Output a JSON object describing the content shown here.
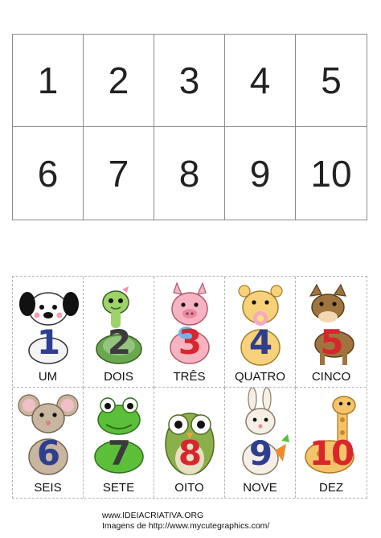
{
  "numbers_table": [
    "1",
    "2",
    "3",
    "4",
    "5",
    "6",
    "7",
    "8",
    "9",
    "10"
  ],
  "cards": [
    {
      "numeral": "1",
      "word": "UM",
      "animal": "puppy-icon",
      "color": "#2e3f8f"
    },
    {
      "numeral": "2",
      "word": "DOIS",
      "animal": "turtle-icon",
      "color": "#3b3b3b"
    },
    {
      "numeral": "3",
      "word": "TRÊS",
      "animal": "pig-icon",
      "color": "#d8262c"
    },
    {
      "numeral": "4",
      "word": "QUATRO",
      "animal": "bear-icon",
      "color": "#2e3f8f"
    },
    {
      "numeral": "5",
      "word": "CINCO",
      "animal": "horse-icon",
      "color": "#d8262c"
    },
    {
      "numeral": "6",
      "word": "SEIS",
      "animal": "mouse-icon",
      "color": "#2e3f8f"
    },
    {
      "numeral": "7",
      "word": "SETE",
      "animal": "frog-icon",
      "color": "#3b3b3b"
    },
    {
      "numeral": "8",
      "word": "OITO",
      "animal": "owl-icon",
      "color": "#d8262c"
    },
    {
      "numeral": "9",
      "word": "NOVE",
      "animal": "bunny-icon",
      "color": "#2e3f8f"
    },
    {
      "numeral": "10",
      "word": "DEZ",
      "animal": "giraffe-icon",
      "color": "#d8262c"
    }
  ],
  "credits": {
    "site": "www.IDEIACRIATIVA.ORG",
    "images": "Imagens de http://www.mycutegraphics.com/"
  }
}
